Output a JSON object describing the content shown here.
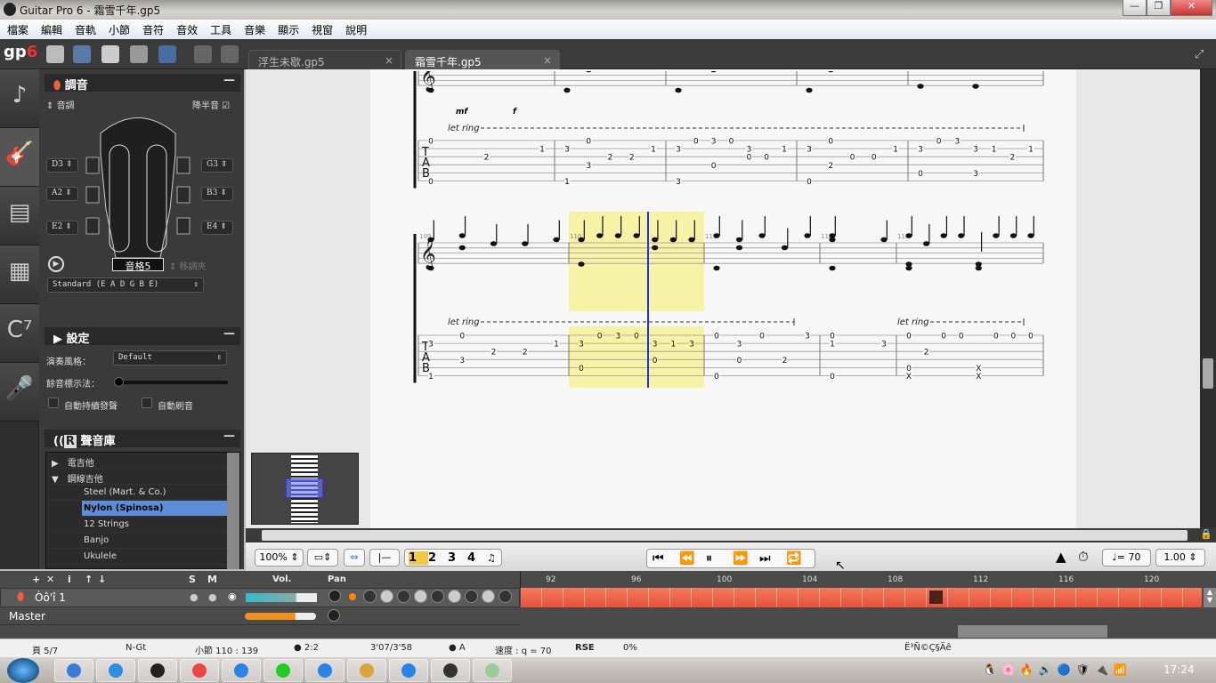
{
  "window": {
    "title": "Guitar Pro 6 - 霜雪千年.gp5",
    "min": "—",
    "max": "❐",
    "close": "✕"
  },
  "menu": [
    "檔案",
    "編輯",
    "音軌",
    "小節",
    "音符",
    "音效",
    "工具",
    "音樂",
    "顯示",
    "視窗",
    "說明"
  ],
  "toolbar": {
    "logo_a": "gp",
    "logo_b": "6",
    "icons": [
      "new-file-icon",
      "open-folder-icon",
      "save-icon",
      "print-icon",
      "info-icon",
      "undo-icon",
      "redo-icon"
    ]
  },
  "tabs": [
    {
      "label": "浮生未歇.gp5",
      "close": "×",
      "active": false
    },
    {
      "label": "霜雪千年.gp5",
      "close": "×",
      "active": true
    }
  ],
  "side_strip": [
    {
      "icon": "♪",
      "name": "notation-icon"
    },
    {
      "icon": "🎸",
      "name": "guitar-icon"
    },
    {
      "icon": "▤",
      "name": "amp-icon"
    },
    {
      "icon": "▦",
      "name": "mixer-icon"
    },
    {
      "icon": "C⁷",
      "name": "chord-icon"
    },
    {
      "icon": "🎤",
      "name": "microphone-icon"
    }
  ],
  "tuning": {
    "title": "調音",
    "key_label": "音調",
    "half_step_label": "降半音",
    "half_step_checked": true,
    "strings_left": [
      "D3",
      "A2",
      "E2"
    ],
    "strings_right": [
      "G3",
      "B3",
      "E4"
    ],
    "capo": "音格5",
    "transpose_label": "移調夾",
    "preset": "Standard (E A D G B E)"
  },
  "settings": {
    "title": "設定",
    "style_label": "演奏風格：",
    "style_value": "Default",
    "ring_label": "餘音標示法：",
    "auto_sustain": "自動持續發聲",
    "auto_mute": "自動刷音",
    "slider_value": 0
  },
  "soundbank": {
    "title": "聲音庫",
    "items": [
      {
        "label": "電吉他",
        "type": "cat",
        "arrow": "▶"
      },
      {
        "label": "鋼線吉他",
        "type": "cat",
        "arrow": "▼"
      },
      {
        "label": "Steel (Mart. & Co.)",
        "type": "item"
      },
      {
        "label": "Nylon (Spinosa)",
        "type": "selected"
      },
      {
        "label": "12 Strings",
        "type": "item"
      },
      {
        "label": "Banjo",
        "type": "item"
      },
      {
        "label": "Ukulele",
        "type": "item"
      }
    ]
  },
  "score": {
    "systems": [
      {
        "dynamics": [
          "mf",
          "f"
        ],
        "let_ring": [
          "let ring"
        ],
        "measures": [
          {
            "number": "",
            "beats": [
              [
                "1:0",
                "6:0"
              ],
              [
                "3:2"
              ],
              [
                "2:1"
              ]
            ]
          },
          {
            "number": "",
            "beats": [
              [
                "2:3",
                "6:1"
              ],
              [
                "1:0",
                "4:3"
              ],
              [
                "3:2"
              ],
              [
                "3:2"
              ],
              [
                "2:1"
              ]
            ]
          },
          {
            "number": "",
            "beats": [
              [
                "2:3",
                "6:3"
              ],
              [
                "1:0"
              ],
              [
                "1:3",
                "4:0"
              ],
              [
                "1:0"
              ],
              [
                "2:3",
                "3:0"
              ],
              [
                "3:0"
              ],
              [
                "2:1"
              ]
            ]
          },
          {
            "number": "",
            "beats": [
              [
                "2:3",
                "6:0"
              ],
              [
                "1:0",
                "4:2"
              ],
              [
                "3:0"
              ],
              [
                "3:0"
              ],
              [
                "2:1"
              ]
            ]
          },
          {
            "number": "",
            "beats": [
              [
                "2:3",
                "5:0"
              ],
              [
                "1:0"
              ],
              [
                "1:3"
              ],
              [
                "2:3",
                "5:3"
              ],
              [
                "2:1"
              ],
              [
                "3:2"
              ],
              [
                "2:1"
              ]
            ]
          }
        ]
      },
      {
        "dynamics": [],
        "let_ring": [
          "let ring",
          "let ring"
        ],
        "measures": [
          {
            "number": "109",
            "beats": [
              [
                "2:3",
                "6:1"
              ],
              [
                "1:0",
                "4:3"
              ],
              [
                "3:2"
              ],
              [
                "3:2"
              ],
              [
                "2:1"
              ]
            ]
          },
          {
            "number": "110",
            "beats": [
              [
                "2:3",
                "5:0"
              ],
              [
                "1:0"
              ],
              [
                "1:3"
              ],
              [
                "1:0"
              ],
              [
                "2:3",
                "4:0"
              ],
              [
                "2:1"
              ],
              [
                "2:3"
              ]
            ]
          },
          {
            "number": "111",
            "beats": [
              [
                "1:0",
                "6:0"
              ],
              [
                "2:3",
                "4:0"
              ],
              [
                "1:0"
              ],
              [
                "4:2"
              ],
              [
                "1:3"
              ]
            ]
          },
          {
            "number": "112",
            "beats": [
              [
                "1:0",
                "2:1",
                "6:0"
              ],
              [
                "2:3"
              ]
            ]
          },
          {
            "number": "113",
            "beats": [
              [
                "1:0",
                "5:0",
                "6:X"
              ],
              [
                "3:2"
              ],
              [
                "1:0"
              ],
              [
                "1:0"
              ],
              [
                "5:X",
                "6:X"
              ],
              [
                "1:0"
              ],
              [
                "1:0"
              ],
              [
                "1:0"
              ]
            ]
          }
        ]
      }
    ],
    "tab_letters": [
      "T",
      "A",
      "B"
    ],
    "highlight_color": "#f6f2a6",
    "cursor_color": "#2233dd"
  },
  "playback": {
    "zoom": "100%",
    "voices": [
      "1",
      "2",
      "3",
      "4"
    ],
    "active_voice": "1",
    "tempo": "♩= 70",
    "speed": "1.00",
    "buttons": [
      "first-icon",
      "rewind-icon",
      "pause-icon",
      "forward-icon",
      "last-icon",
      "loop-icon"
    ],
    "glyphs": [
      "⏮",
      "⏪",
      "⏸",
      "⏩",
      "⏭",
      "🔁"
    ]
  },
  "tracks": {
    "header": {
      "tools": [
        "+",
        "✕",
        "i",
        "↑",
        "↓"
      ],
      "solo": "S",
      "mute": "M",
      "vol": "Vol.",
      "pan": "Pan"
    },
    "track_name": "Òô'î 1",
    "master": "Master",
    "ruler": [
      "92",
      "96",
      "100",
      "104",
      "108",
      "112",
      "116",
      "120"
    ],
    "track_color": "#e9503a"
  },
  "status": {
    "page": "頁 5/7",
    "instrument": "N-Gt",
    "bar": "小節 110 : 139",
    "sig": "2:2",
    "time": "3'07/3'58",
    "key": "A",
    "tempo": "速度 : q = 70",
    "rse": "RSE",
    "cpu": "0%",
    "msg": "Ë³Ñ©Ç§Äê"
  },
  "taskbar": {
    "clock": "17:24"
  }
}
